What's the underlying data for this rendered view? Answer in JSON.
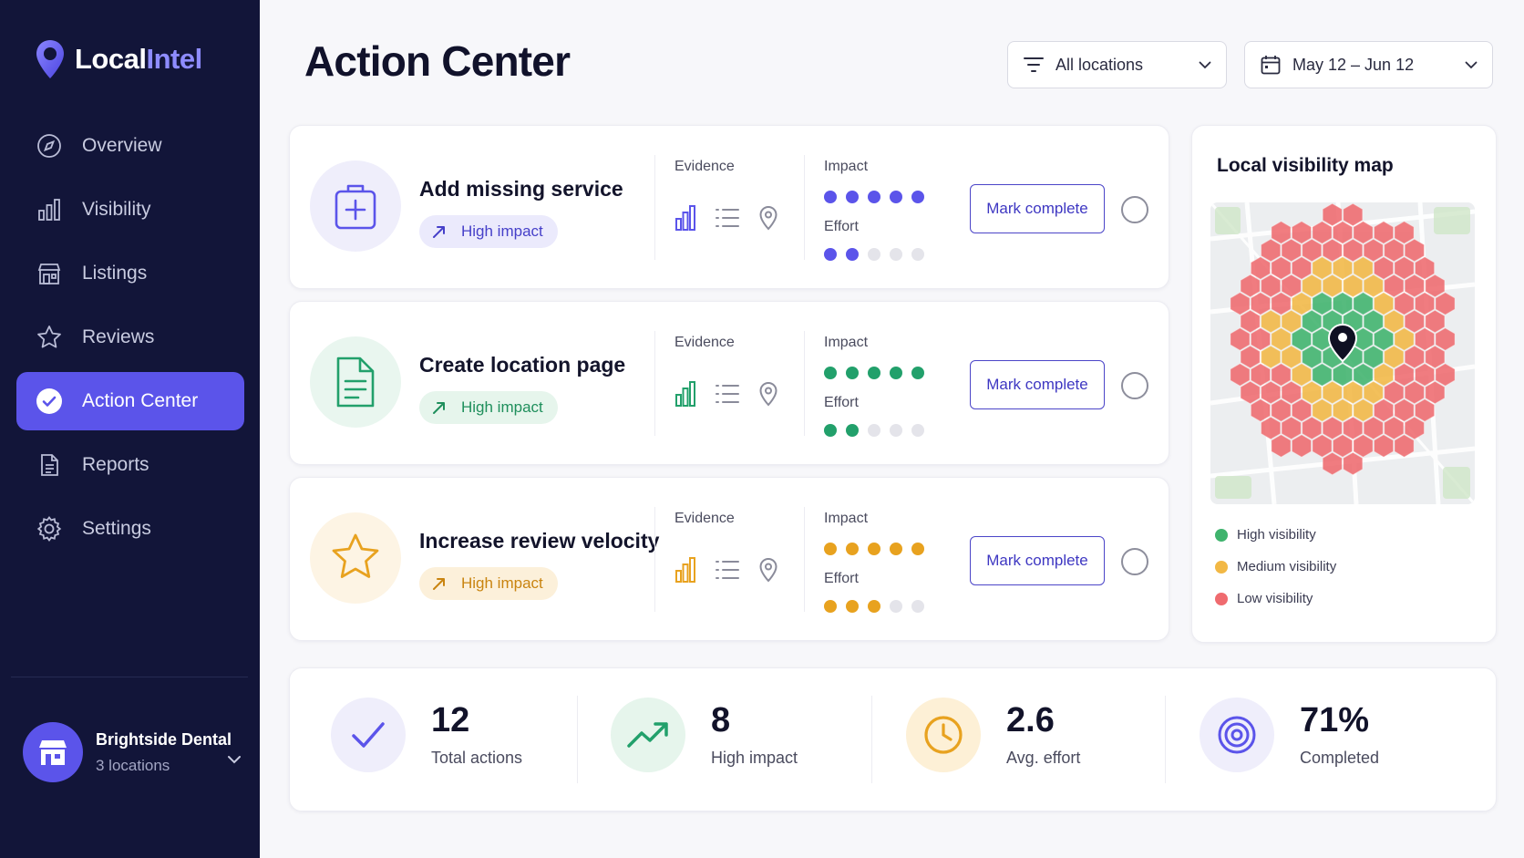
{
  "brand": {
    "name_part1": "Local",
    "name_part2": "Intel",
    "accent": "#8e8cff"
  },
  "sidebar": {
    "items": [
      {
        "label": "Overview",
        "icon": "compass-icon"
      },
      {
        "label": "Visibility",
        "icon": "bar-chart-icon"
      },
      {
        "label": "Listings",
        "icon": "storefront-icon"
      },
      {
        "label": "Reviews",
        "icon": "star-icon"
      },
      {
        "label": "Action Center",
        "icon": "check-circle-icon",
        "active": true
      },
      {
        "label": "Reports",
        "icon": "document-icon"
      },
      {
        "label": "Settings",
        "icon": "gear-icon"
      }
    ],
    "account": {
      "name": "Brightside Dental",
      "sub": "3 locations"
    }
  },
  "header": {
    "title": "Action Center",
    "location_filter": "All locations",
    "date_range": "May 12 – Jun 12"
  },
  "actions": [
    {
      "title": "Add missing service",
      "badge": "High impact",
      "evidence_label": "Evidence",
      "impact_label": "Impact",
      "effort_label": "Effort",
      "impact": 5,
      "effort": 2,
      "color": "#5b54ea",
      "button": "Mark complete",
      "icon": "medical-kit-icon"
    },
    {
      "title": "Create location page",
      "badge": "High impact",
      "evidence_label": "Evidence",
      "impact_label": "Impact",
      "effort_label": "Effort",
      "impact": 5,
      "effort": 2,
      "color": "#22a06b",
      "button": "Mark complete",
      "icon": "document-icon"
    },
    {
      "title": "Increase review velocity",
      "badge": "High impact",
      "evidence_label": "Evidence",
      "impact_label": "Impact",
      "effort_label": "Effort",
      "impact": 5,
      "effort": 3,
      "color": "#e8a21f",
      "button": "Mark complete",
      "icon": "star-icon"
    }
  ],
  "map": {
    "title": "Local visibility map",
    "legend": [
      {
        "label": "High visibility",
        "color": "#3fb36d"
      },
      {
        "label": "Medium visibility",
        "color": "#f2b845"
      },
      {
        "label": "Low visibility",
        "color": "#ef6b6f"
      }
    ]
  },
  "stats": [
    {
      "value": "12",
      "label": "Total actions",
      "icon": "checkmark-icon"
    },
    {
      "value": "8",
      "label": "High impact",
      "icon": "trend-up-icon"
    },
    {
      "value": "2.6",
      "label": "Avg. effort",
      "icon": "clock-icon"
    },
    {
      "value": "71%",
      "label": "Completed",
      "icon": "target-icon"
    }
  ]
}
